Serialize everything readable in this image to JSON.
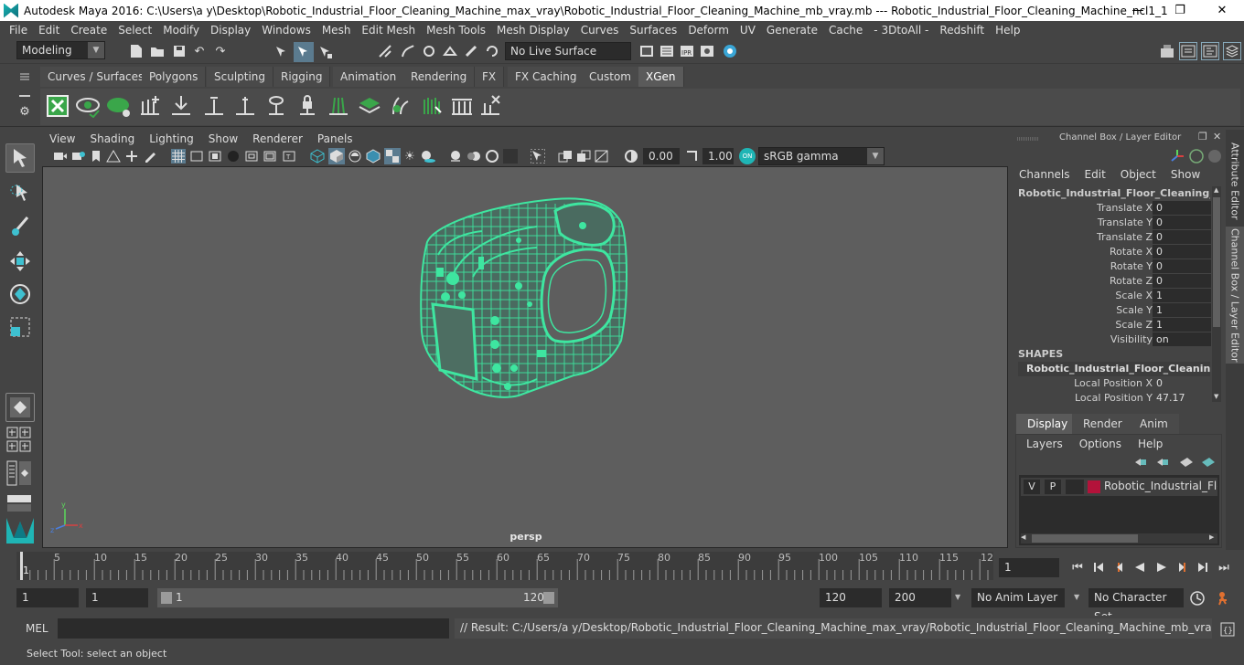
{
  "window": {
    "title": "Autodesk Maya 2016: C:\\Users\\a y\\Desktop\\Robotic_Industrial_Floor_Cleaning_Machine_max_vray\\Robotic_Industrial_Floor_Cleaning_Machine_mb_vray.mb  ---  Robotic_Industrial_Floor_Cleaning_Machine_ncl1_1",
    "minimize": "—",
    "restore": "❐",
    "close": "✕"
  },
  "menubar": [
    "File",
    "Edit",
    "Create",
    "Select",
    "Modify",
    "Display",
    "Windows",
    "Mesh",
    "Edit Mesh",
    "Mesh Tools",
    "Mesh Display",
    "Curves",
    "Surfaces",
    "Deform",
    "UV",
    "Generate",
    "Cache",
    "- 3DtoAll -",
    "Redshift",
    "Help"
  ],
  "statusline": {
    "mode": "Modeling",
    "live_surface": "No Live Surface"
  },
  "shelf_tabs": [
    "Curves / Surfaces",
    "Polygons",
    "Sculpting",
    "Rigging",
    "Animation",
    "Rendering",
    "FX",
    "FX Caching",
    "Custom",
    "XGen"
  ],
  "shelf_active": "XGen",
  "viewport": {
    "menu": [
      "View",
      "Shading",
      "Lighting",
      "Show",
      "Renderer",
      "Panels"
    ],
    "exposure": "0.00",
    "gamma": "1.00",
    "colorspace": "sRGB gamma",
    "camera": "persp"
  },
  "channel_box": {
    "header": "Channel Box / Layer Editor",
    "menu": [
      "Channels",
      "Edit",
      "Object",
      "Show"
    ],
    "object": "Robotic_Industrial_Floor_Cleaning_M...",
    "attributes": [
      {
        "name": "Translate X",
        "value": "0"
      },
      {
        "name": "Translate Y",
        "value": "0"
      },
      {
        "name": "Translate Z",
        "value": "0"
      },
      {
        "name": "Rotate X",
        "value": "0"
      },
      {
        "name": "Rotate Y",
        "value": "0"
      },
      {
        "name": "Rotate Z",
        "value": "0"
      },
      {
        "name": "Scale X",
        "value": "1"
      },
      {
        "name": "Scale Y",
        "value": "1"
      },
      {
        "name": "Scale Z",
        "value": "1"
      },
      {
        "name": "Visibility",
        "value": "on"
      }
    ],
    "shapes_label": "SHAPES",
    "shape_object": "Robotic_Industrial_Floor_Cleaning_...",
    "shape_attributes": [
      {
        "name": "Local Position X",
        "value": "0"
      },
      {
        "name": "Local Position Y",
        "value": "47.17"
      }
    ]
  },
  "side_tabs": {
    "attribute_editor": "Attribute Editor",
    "channel_box": "Channel Box / Layer Editor"
  },
  "layer_editor": {
    "tabs": [
      "Display",
      "Render",
      "Anim"
    ],
    "active_tab": "Display",
    "menu": [
      "Layers",
      "Options",
      "Help"
    ],
    "layer": {
      "v": "V",
      "p": "P",
      "name": "Robotic_Industrial_Floor",
      "color": "#b3123a"
    }
  },
  "timeline": {
    "ticks": [
      "5",
      "10",
      "15",
      "20",
      "25",
      "30",
      "35",
      "40",
      "45",
      "50",
      "55",
      "60",
      "65",
      "70",
      "75",
      "80",
      "85",
      "90",
      "95",
      "100",
      "105",
      "110",
      "115",
      "12"
    ],
    "first": "1",
    "current_frame": "1"
  },
  "range": {
    "start": "1",
    "playback_start": "1",
    "slider_start": "1",
    "slider_end": "120",
    "playback_end": "120",
    "end": "200",
    "anim_layer": "No Anim Layer",
    "character_set": "No Character Set"
  },
  "command_line": {
    "label": "MEL",
    "result": "// Result: C:/Users/a y/Desktop/Robotic_Industrial_Floor_Cleaning_Machine_max_vray/Robotic_Industrial_Floor_Cleaning_Machine_mb_vray.mb"
  },
  "help_line": "Select Tool: select an object",
  "colors": {
    "wire": "#3ee6a0",
    "accent": "#1fb5b5",
    "layer": "#b3123a"
  }
}
